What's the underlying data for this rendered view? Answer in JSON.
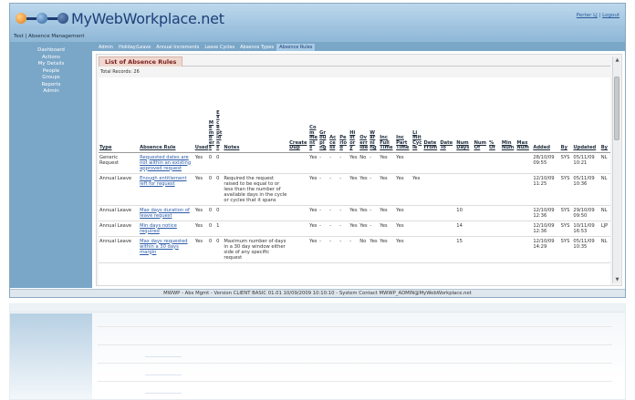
{
  "app": {
    "logo_text": "MyWebWorkplace.net",
    "context": "Test | Absence Management"
  },
  "user_links": {
    "user": "Perter LJ",
    "separator": " | ",
    "logout": "Logout"
  },
  "sidebar": {
    "items": [
      {
        "label": "Dashboard"
      },
      {
        "label": "Actions"
      },
      {
        "label": "My Details"
      },
      {
        "label": "People"
      },
      {
        "label": "Groups"
      },
      {
        "label": "Reports"
      },
      {
        "label": "Admin"
      }
    ]
  },
  "tabs": [
    {
      "label": "Admin",
      "active": false
    },
    {
      "label": "Holiday/Leave",
      "active": false
    },
    {
      "label": "Annual Increments",
      "active": false
    },
    {
      "label": "Leave Cycles",
      "active": false
    },
    {
      "label": "Absence Types",
      "active": false
    },
    {
      "label": "Absence Rules",
      "active": true
    }
  ],
  "main": {
    "title": "List of Absence Rules",
    "total_records": "Total Records: 26"
  },
  "table": {
    "columns": [
      "Type",
      "Absence Rule",
      "Used",
      "Members",
      "Exceptions",
      "Notes",
      "Create Dup",
      "Comments",
      "Grouping",
      "Access",
      "Period",
      "History",
      "Override",
      "Warning",
      "Inc Full Time",
      "Inc Part Time",
      "Limit Cycle",
      "Date From",
      "Date To",
      "Num Days",
      "Num Of",
      "% Of",
      "Min Num",
      "Max Num",
      "Added",
      "By",
      "Updated",
      "By"
    ],
    "rows": [
      {
        "type": "Generic Request",
        "rule": "Requested dates are not within an existing approved request",
        "used": "Yes",
        "members": "0",
        "exceptions": "0",
        "notes": "",
        "create_dup": "",
        "comments": "Yes",
        "grouping": "-",
        "access": "-",
        "period": "-",
        "history": "Yes",
        "override": "No",
        "warning": "-",
        "full": "Yes",
        "part": "Yes",
        "limit_cycle": "",
        "date_from": "",
        "date_to": "",
        "num_days": "",
        "num_of": "",
        "pct_of": "",
        "min_num": "",
        "max_num": "",
        "added": "28/10/09 09:55",
        "added_by": "SYS",
        "updated": "05/11/09 10:21",
        "updated_by": "NL"
      },
      {
        "type": "Annual Leave",
        "rule": "Enough entitlement left for request",
        "used": "Yes",
        "members": "0",
        "exceptions": "0",
        "notes": "Required the request raised to be equal to or less than the number of available days in the cycle or cycles that it spans",
        "create_dup": "",
        "comments": "Yes",
        "grouping": "-",
        "access": "-",
        "period": "-",
        "history": "Yes",
        "override": "Yes",
        "warning": "-",
        "full": "Yes",
        "part": "Yes",
        "limit_cycle": "Yes",
        "date_from": "",
        "date_to": "",
        "num_days": "",
        "num_of": "",
        "pct_of": "",
        "min_num": "",
        "max_num": "",
        "added": "12/10/09 11:25",
        "added_by": "SYS",
        "updated": "05/11/09 10:36",
        "updated_by": "NL"
      },
      {
        "type": "Annual Leave",
        "rule": "Max days duration of leave request",
        "used": "Yes",
        "members": "0",
        "exceptions": "0",
        "notes": "",
        "create_dup": "",
        "comments": "Yes",
        "grouping": "-",
        "access": "-",
        "period": "-",
        "history": "Yes",
        "override": "Yes",
        "warning": "-",
        "full": "Yes",
        "part": "Yes",
        "limit_cycle": "",
        "date_from": "",
        "date_to": "",
        "num_days": "10",
        "num_of": "",
        "pct_of": "",
        "min_num": "",
        "max_num": "",
        "added": "12/10/09 12:36",
        "added_by": "SYS",
        "updated": "29/10/09 09:50",
        "updated_by": "NL"
      },
      {
        "type": "Annual Leave",
        "rule": "Min days notice required",
        "used": "Yes",
        "members": "0",
        "exceptions": "1",
        "notes": "",
        "create_dup": "",
        "comments": "Yes",
        "grouping": "-",
        "access": "-",
        "period": "-",
        "history": "Yes",
        "override": "Yes",
        "warning": "-",
        "full": "Yes",
        "part": "Yes",
        "limit_cycle": "",
        "date_from": "",
        "date_to": "",
        "num_days": "14",
        "num_of": "",
        "pct_of": "",
        "min_num": "",
        "max_num": "",
        "added": "12/10/09 12:36",
        "added_by": "SYS",
        "updated": "10/11/09 16:53",
        "updated_by": "LJP"
      },
      {
        "type": "Annual Leave",
        "rule": "Max days requested within a 30 days margin",
        "used": "Yes",
        "members": "0",
        "exceptions": "0",
        "notes": "Maximum number of days in a 30 day window either side of any specific request",
        "create_dup": "",
        "comments": "Yes",
        "grouping": "-",
        "access": "-",
        "period": "-",
        "history": "-",
        "override": "No",
        "warning": "Yes",
        "full": "Yes",
        "part": "Yes",
        "limit_cycle": "",
        "date_from": "",
        "date_to": "",
        "num_days": "15",
        "num_of": "",
        "pct_of": "",
        "min_num": "",
        "max_num": "",
        "added": "12/10/09 14:29",
        "added_by": "SYS",
        "updated": "05/11/09 10:35",
        "updated_by": "NL"
      }
    ]
  },
  "footer": "MWWP - Abs Mgmt - Version CLIENT BASIC 01.01 10/09/2009 10:10:10 - System Contact MWWP_ADMIN@MyWebWorkplace.net"
}
